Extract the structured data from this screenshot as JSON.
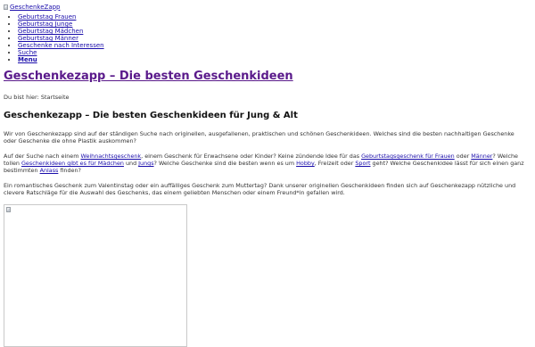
{
  "logo": {
    "alt": "GeschenkeZapp"
  },
  "nav": {
    "items": [
      "Geburtstag Frauen",
      "Geburtstag Junge",
      "Geburtstag Mädchen",
      "Geburtstag Männer",
      "Geschenke nach Interessen",
      "Suche"
    ],
    "menu_label": "Menu"
  },
  "site_title": "Geschenkezapp – Die besten Geschenkideen",
  "breadcrumb": {
    "prefix": "Du bist hier:",
    "current": "Startseite"
  },
  "page_heading": "Geschenkezapp – Die besten Geschenkideen für Jung & Alt",
  "paragraph1": "Wir von Geschenkezapp sind auf der ständigen Suche nach originellen, ausgefallenen, praktischen und schönen Geschenkideen. Welches sind die besten nachhaltigen Geschenke oder Geschenke die ohne Plastik auskommen?",
  "paragraph2": {
    "t1": "Auf der Suche nach einem ",
    "l1": "Weihnachtsgeschenk",
    "t2": ", einem Geschenk für Erwachsene oder Kinder? Keine zündende Idee für das ",
    "l2": "Geburtstagsgeschenk für Frauen",
    "t3": " oder ",
    "l3": "Männer",
    "t4": "? Welche tollen ",
    "l4": "Geschenkideen gibt es für Mädchen",
    "t5": " und ",
    "l5": "Jungs",
    "t6": "? Welche Geschenke sind die besten wenn es um ",
    "l6": "Hobby",
    "t7": ", Freizeit oder ",
    "l7": "Sport",
    "t8": " geht? Welche Geschenkidee lässt für sich einen ganz bestimmten ",
    "l8": "Anlass",
    "t9": " finden?"
  },
  "paragraph3": "Ein romantisches Geschenk zum Valentinstag oder ein auffälliges Geschenk zum Muttertag? Dank unserer originellen Geschenkideen finden sich auf Geschenkezapp nützliche und clevere Ratschläge für die Auswahl des Geschenks, das einem geliebten Menschen oder einem Freund*in gefallen wird."
}
